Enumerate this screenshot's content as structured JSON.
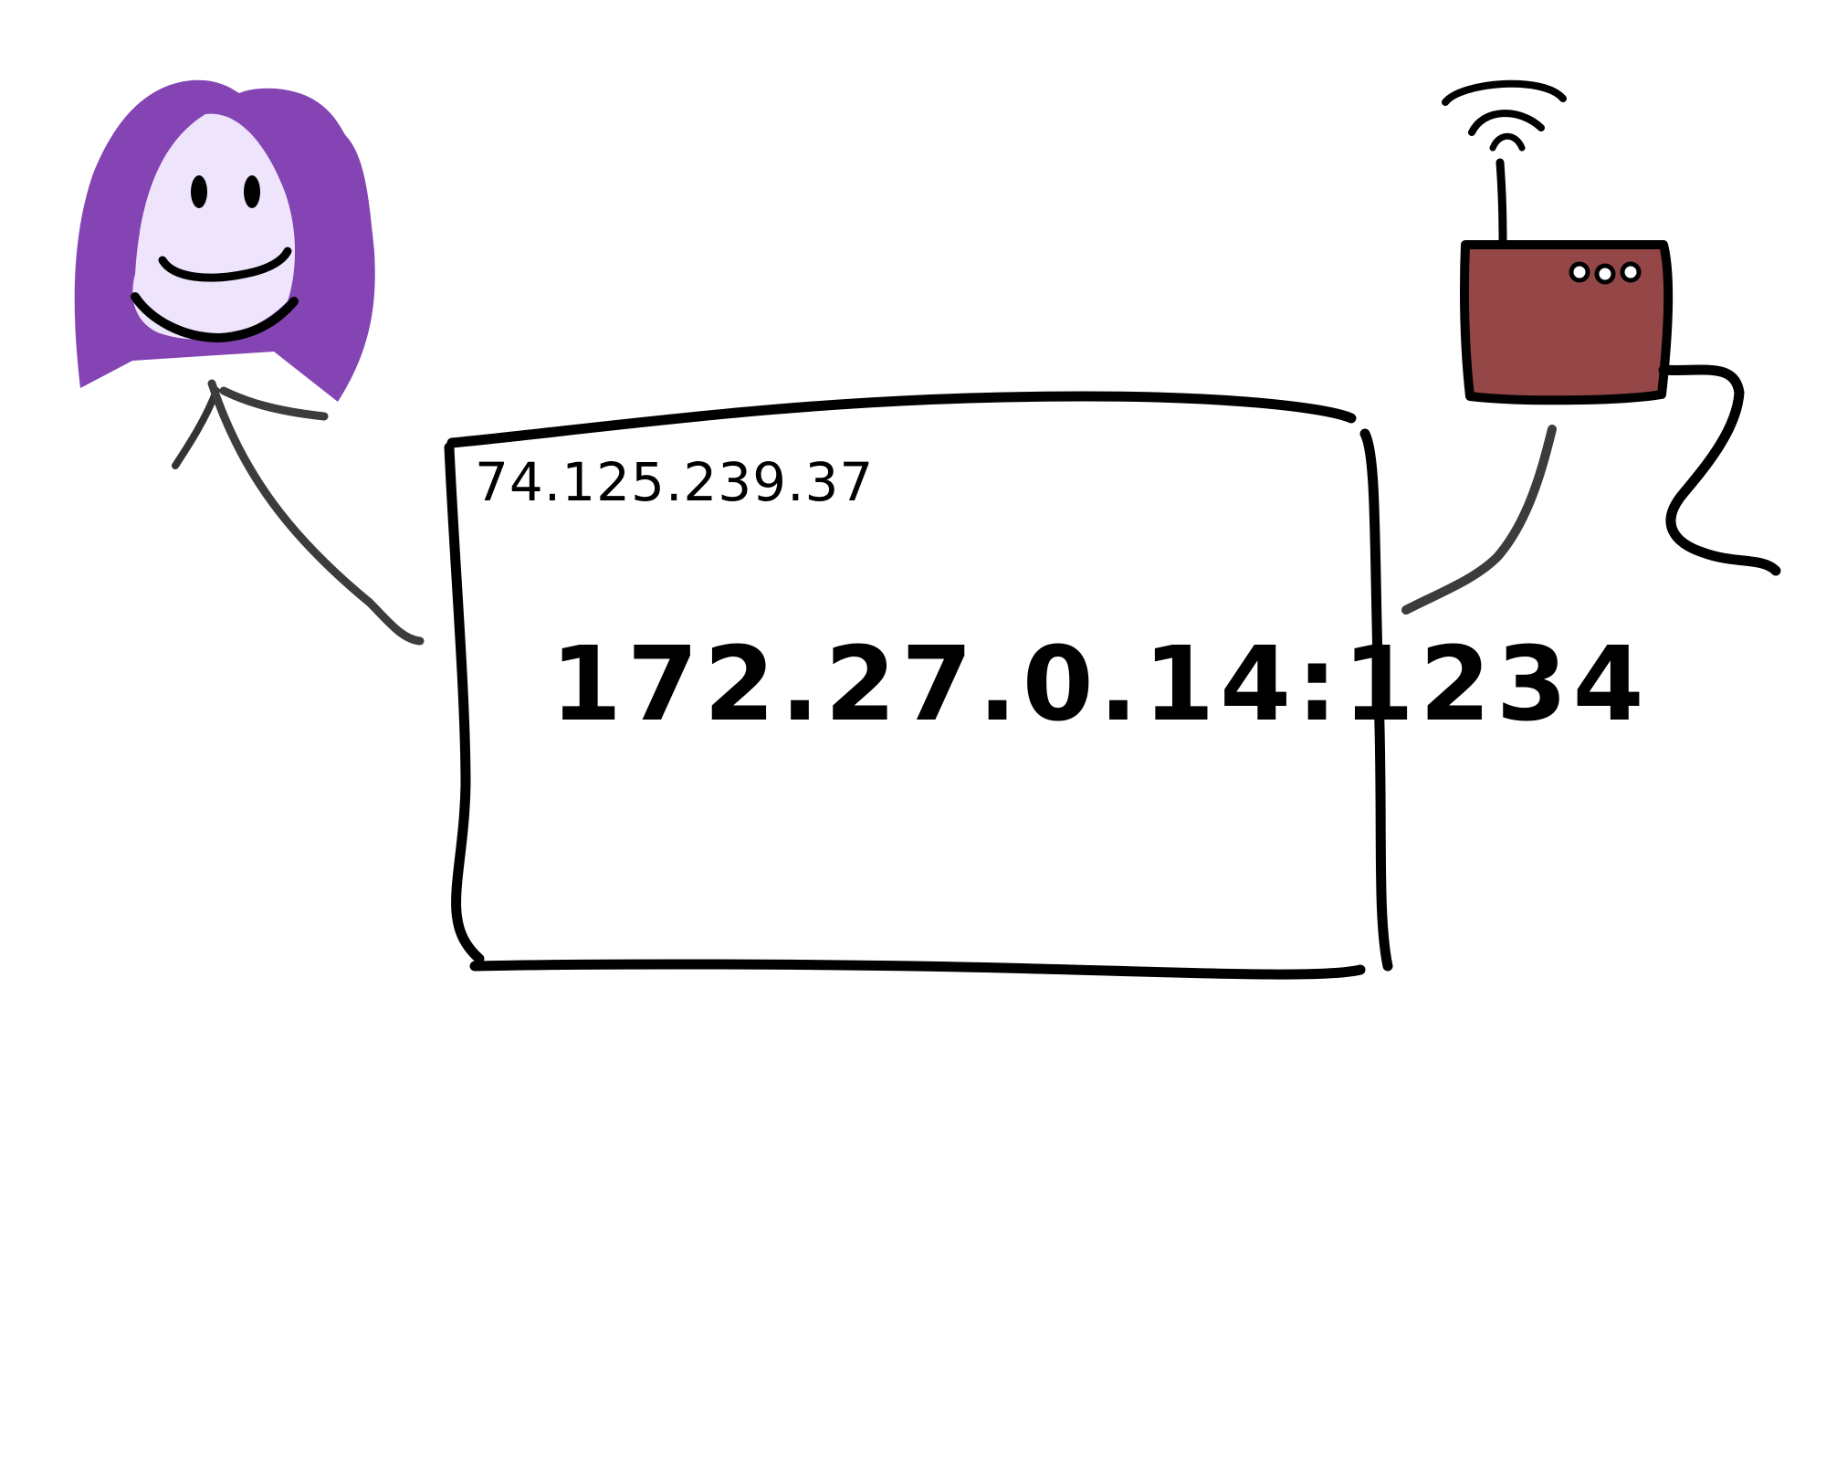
{
  "labels": {
    "public_ip": "74.125.239.37",
    "private_address": "172.27.0.14:1234"
  },
  "colors": {
    "hair": "#8444B3",
    "face": "#EEE4FB",
    "outline": "#000000",
    "router_body": "#954747",
    "cable": "#3C3C3C"
  },
  "icons": {
    "person": "person-icon",
    "router": "router-icon",
    "wifi": "wifi-signal-icon"
  }
}
